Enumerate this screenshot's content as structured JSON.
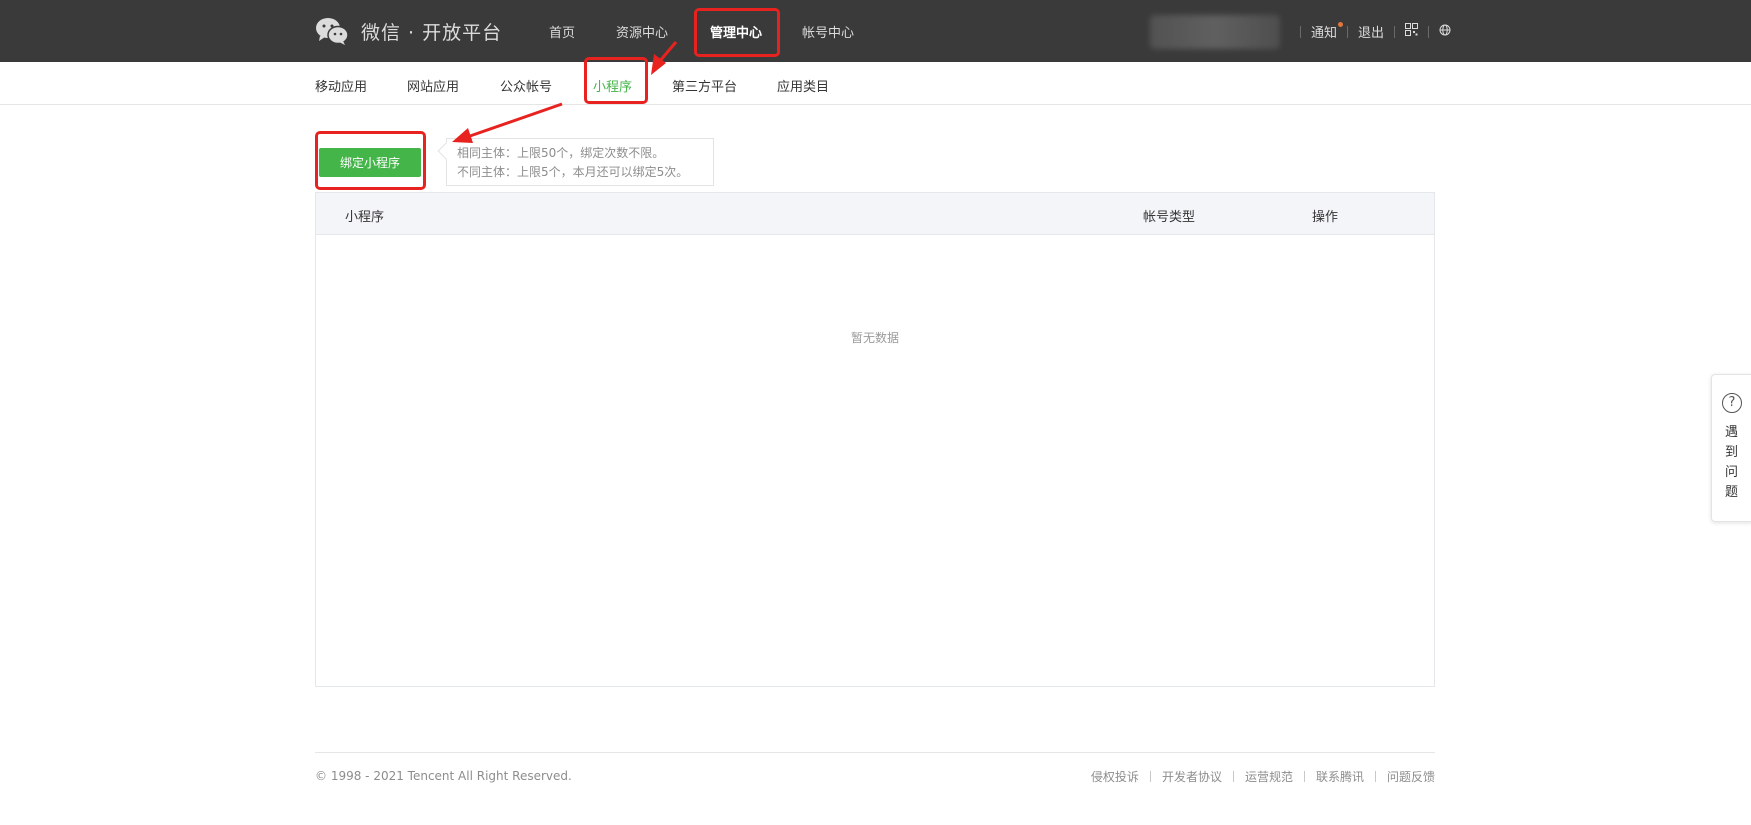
{
  "brand": {
    "name": "微信 · 开放平台",
    "icon": "wechat-icon"
  },
  "top_nav": [
    {
      "label": "首页"
    },
    {
      "label": "资源中心"
    },
    {
      "label": "管理中心",
      "active": true
    },
    {
      "label": "帐号中心"
    }
  ],
  "top_right": {
    "notify": "通知",
    "logout": "退出",
    "qrcode_icon": "qrcode-icon",
    "language_icon": "globe-icon"
  },
  "sub_nav": [
    {
      "label": "移动应用"
    },
    {
      "label": "网站应用"
    },
    {
      "label": "公众帐号"
    },
    {
      "label": "小程序",
      "active": true
    },
    {
      "label": "第三方平台"
    },
    {
      "label": "应用类目"
    }
  ],
  "bind": {
    "button_label": "绑定小程序",
    "tip_line1": "相同主体：上限50个，绑定次数不限。",
    "tip_line2": "不同主体：上限5个，本月还可以绑定5次。"
  },
  "table": {
    "columns": [
      "小程序",
      "帐号类型",
      "操作"
    ],
    "empty_text": "暂无数据"
  },
  "footer": {
    "copyright": "© 1998 - 2021 Tencent All Right Reserved.",
    "links": [
      "侵权投诉",
      "开发者协议",
      "运营规范",
      "联系腾讯",
      "问题反馈"
    ]
  },
  "help": {
    "icon": "question-icon",
    "label": "遇到问题"
  },
  "colors": {
    "accent": "#44b549",
    "topbar": "#3a3a3a",
    "annotation": "#e8231f"
  }
}
